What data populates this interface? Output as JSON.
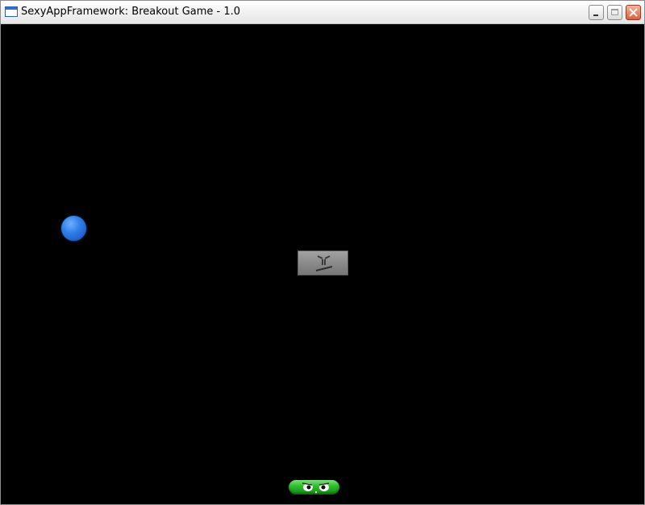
{
  "window": {
    "title": "SexyAppFramework: Breakout Game - 1.0",
    "buttons": {
      "minimize_icon": "minimize-icon",
      "maximize_icon": "maximize-icon",
      "close_icon": "close-icon"
    }
  },
  "game": {
    "background_color": "#000000",
    "ball_color": "#2f7fe8",
    "brick_color": "#8d8d8d",
    "paddle_color": "#2fbf2f",
    "objects": [
      "ball",
      "brick",
      "paddle"
    ]
  }
}
